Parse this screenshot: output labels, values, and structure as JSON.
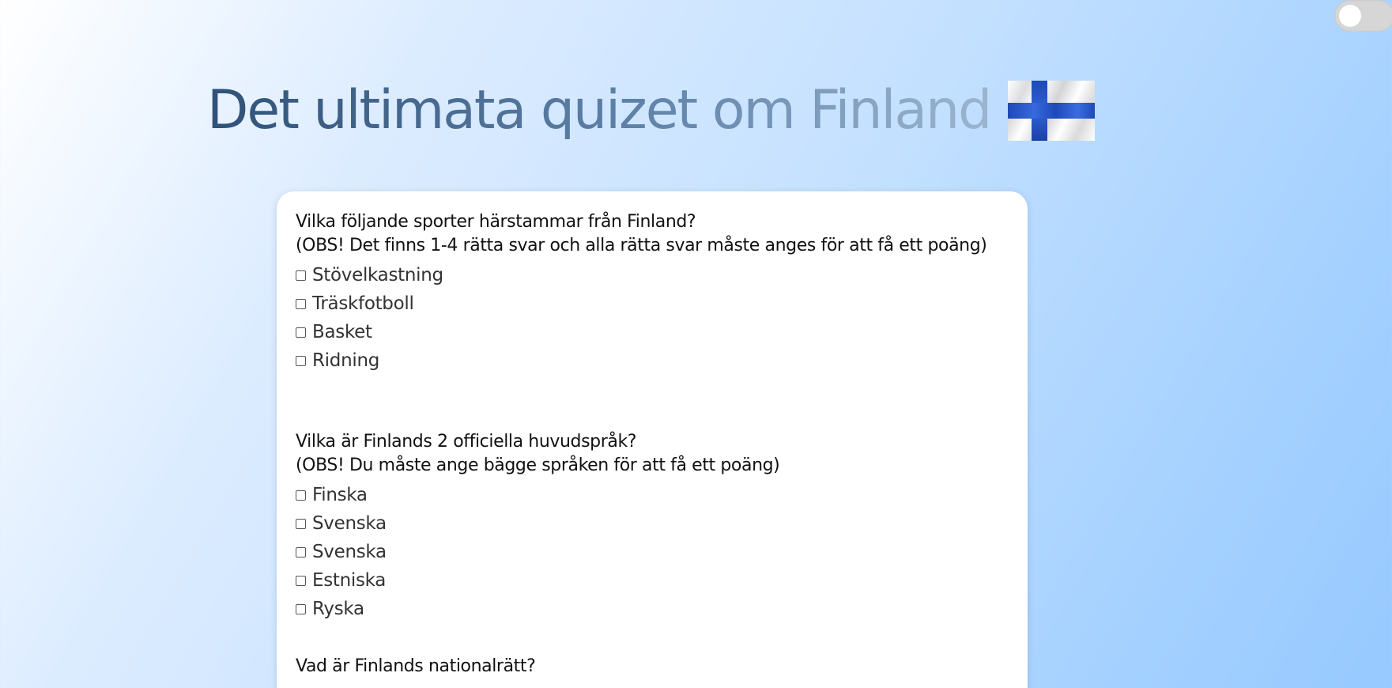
{
  "title": "Det ultimata quizet om Finland",
  "flag_icon": "finland-flag-icon",
  "theme_toggle": {
    "state": "off"
  },
  "questions": [
    {
      "line1": "Vilka följande sporter härstammar från Finland?",
      "line2": "(OBS! Det finns 1-4 rätta svar och alla rätta svar måste anges för att få ett poäng)",
      "options": [
        "Stövelkastning",
        "Träskfotboll",
        "Basket",
        "Ridning"
      ]
    },
    {
      "line1": "Vilka är Finlands 2 officiella huvudspråk?",
      "line2": "(OBS! Du måste ange bägge språken för att få ett poäng)",
      "options": [
        "Finska",
        "Svenska",
        "Svenska",
        "Estniska",
        "Ryska"
      ]
    },
    {
      "line1": "Vad är Finlands nationalrätt?",
      "line2": "",
      "options": []
    }
  ],
  "colors": {
    "title_gradient_start": "#2f5178",
    "title_gradient_end": "#9bb5cf",
    "flag_blue": "#1f49b8",
    "card_bg": "#ffffff"
  }
}
